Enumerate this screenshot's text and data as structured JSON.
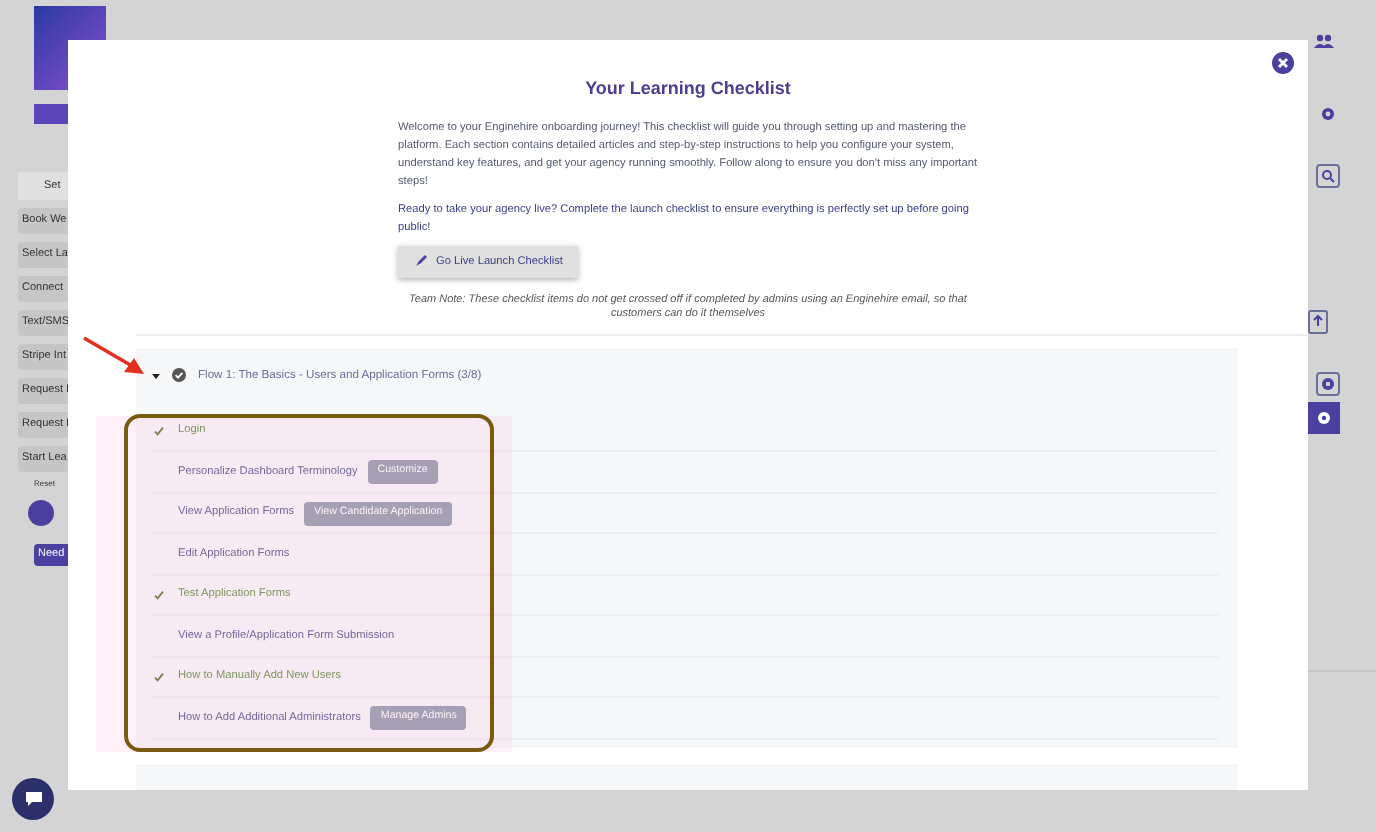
{
  "sidebar": {
    "heading": "Set",
    "items": [
      "Book We",
      "Select La",
      "Connect",
      "Text/SMS",
      "Stripe Int",
      "Request I",
      "Request I",
      "Start Lea"
    ],
    "reset_label": "Reset",
    "help_button": "Need"
  },
  "modal": {
    "title": "Your Learning Checklist",
    "intro": "Welcome to your Enginehire onboarding journey! This checklist will guide you through setting up and mastering the platform. Each section contains detailed articles and step-by-step instructions to help you configure your system, understand key features, and get your agency running smoothly. Follow along to ensure you don't miss any important steps!",
    "prompt": "Ready to take your agency live? Complete the launch checklist to ensure everything is perfectly set up before going public!",
    "launch_button": "Go Live Launch Checklist",
    "note": "Team Note: These checklist items do not get crossed off if completed by admins using an Enginehire email, so that customers can do it themselves",
    "sections": [
      {
        "title": "Flow 1: The Basics - Users and Application Forms (3/8)",
        "expanded": true,
        "items": [
          {
            "label": "Login",
            "done": true
          },
          {
            "label": "Personalize Dashboard Terminology",
            "done": false,
            "action": "Customize"
          },
          {
            "label": "View Application Forms",
            "done": false,
            "action": "View Candidate Application"
          },
          {
            "label": "Edit Application Forms",
            "done": false
          },
          {
            "label": "Test Application Forms",
            "done": true
          },
          {
            "label": "View a Profile/Application Form Submission",
            "done": false
          },
          {
            "label": "How to Manually Add New Users",
            "done": true
          },
          {
            "label": "How to Add Additional Administrators",
            "done": false,
            "action": "Manage Admins"
          }
        ]
      }
    ]
  }
}
